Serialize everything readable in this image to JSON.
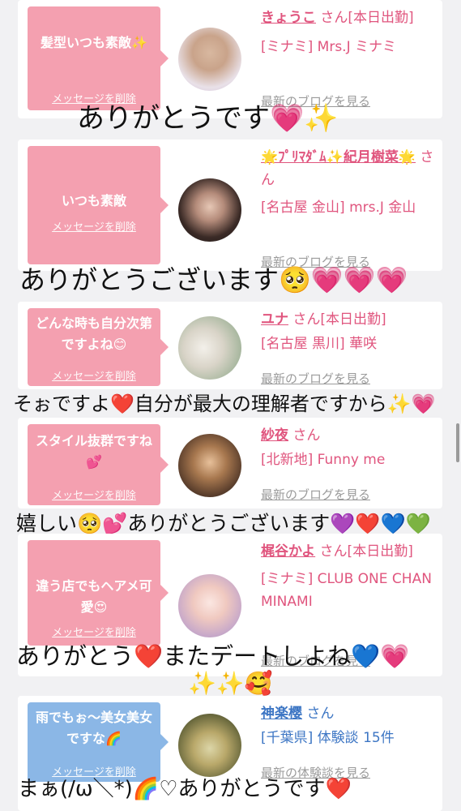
{
  "delete_label": "メッセージを削除",
  "cards": [
    {
      "message": "髪型いつも素敵✨",
      "name": "きょうこ",
      "san": "さん[本日出勤]",
      "shop": "[ミナミ] Mrs.J ミナミ",
      "blog": "最新のブログを見る",
      "caption": "ありがとうです💗✨"
    },
    {
      "message": "いつも素敵",
      "name": "🌟ﾌﾟﾘﾏﾀﾞﾑ✨紀月樹菜🌟",
      "san": "さん",
      "shop": "[名古屋 金山] mrs.J 金山",
      "blog": "最新のブログを見る",
      "caption": "ありがとうございます🥺💗💗💗"
    },
    {
      "message": "どんな時も自分次第ですよね😊",
      "name": "ユナ",
      "san": "さん[本日出勤]",
      "shop": "[名古屋 黒川] 華咲",
      "blog": "最新のブログを見る",
      "caption": "そぉですよ❤️自分が最大の理解者ですから✨💗"
    },
    {
      "message": "スタイル抜群ですね💕",
      "name": "紗夜",
      "san": "さん",
      "shop": "[北新地] Funny me",
      "blog": "最新のブログを見る",
      "caption": "嬉しい🥺💕ありがとうございます💜❤️💙💚"
    },
    {
      "message": "違う店でもヘアメ可愛😍",
      "name": "梶谷かよ",
      "san": "さん[本日出勤]",
      "shop": "[ミナミ] CLUB ONE CHAN MINAMI",
      "blog": "最新のブログを見る",
      "caption": "ありがとう❤️またデートしよね💙💗",
      "caption2": "✨✨🥰"
    },
    {
      "message": "雨でもぉ〜美女美女ですな🌈",
      "name": "神楽樱",
      "san": "さん",
      "shop": "[千葉県] 体験談 15件",
      "blog": "最新の体験談を見る",
      "caption": "まぁ(/ω＼*)🌈♡ありがとうです❤️"
    }
  ],
  "colors": {
    "pink_bubble": "#f4a0b0",
    "blue_bubble": "#8bb7e6",
    "pink_text": "#e0557e",
    "blue_text": "#3d76c4"
  }
}
